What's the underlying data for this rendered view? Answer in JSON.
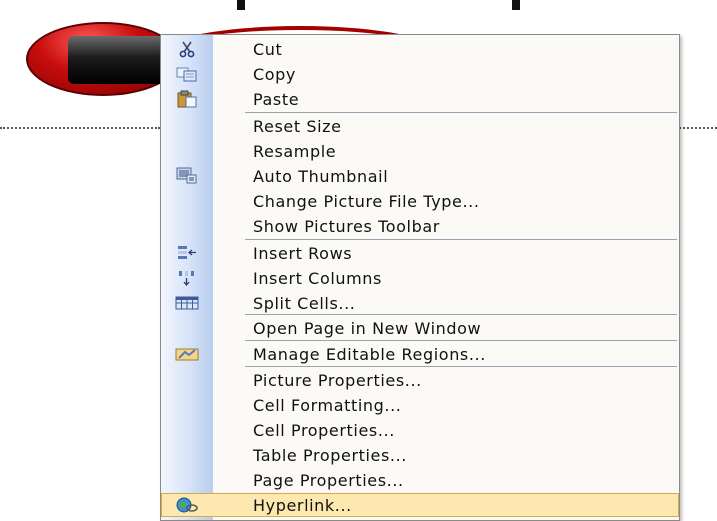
{
  "menu": {
    "items": [
      {
        "label": "Cut",
        "icon": "scissors-icon"
      },
      {
        "label": "Copy",
        "icon": "copy-icon"
      },
      {
        "label": "Paste",
        "icon": "paste-icon"
      },
      {
        "label": "Reset Size",
        "icon": null
      },
      {
        "label": "Resample",
        "icon": null
      },
      {
        "label": "Auto Thumbnail",
        "icon": "thumbnail-icon"
      },
      {
        "label": "Change Picture File Type...",
        "icon": null
      },
      {
        "label": "Show Pictures Toolbar",
        "icon": null
      },
      {
        "label": "Insert Rows",
        "icon": "insert-rows-icon"
      },
      {
        "label": "Insert Columns",
        "icon": "insert-columns-icon"
      },
      {
        "label": "Split Cells...",
        "icon": "split-cells-icon"
      },
      {
        "label": "Open Page in New Window",
        "icon": null
      },
      {
        "label": "Manage Editable Regions...",
        "icon": "editable-regions-icon"
      },
      {
        "label": "Picture Properties...",
        "icon": null
      },
      {
        "label": "Cell Formatting...",
        "icon": null
      },
      {
        "label": "Cell Properties...",
        "icon": null
      },
      {
        "label": "Table Properties...",
        "icon": null
      },
      {
        "label": "Page Properties...",
        "icon": null
      },
      {
        "label": "Hyperlink...",
        "icon": "hyperlink-globe-icon"
      }
    ],
    "highlighted_item": "Hyperlink..."
  },
  "colors": {
    "menu_background": "#fbfaf6",
    "icon_strip": "#c8d8f4",
    "highlight": "#fde8b0",
    "highlight_border": "#d6a94a",
    "button_red": "#c80d0d"
  }
}
